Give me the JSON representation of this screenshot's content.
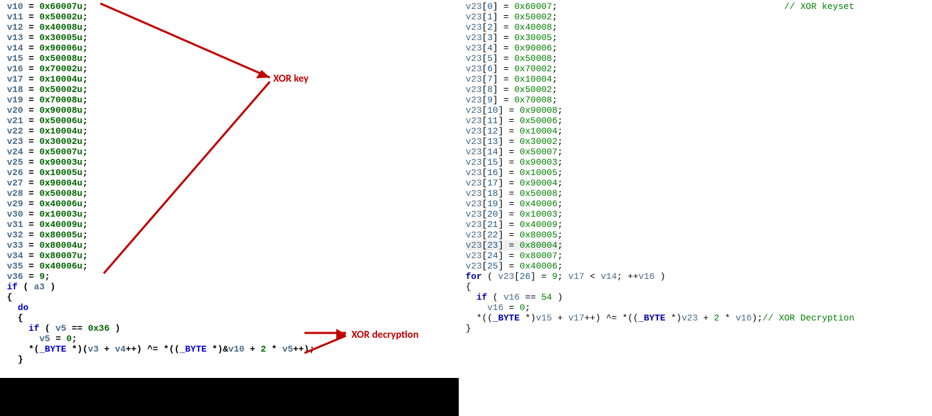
{
  "left": {
    "assignments": [
      {
        "name": "v10",
        "val": "0x60007u"
      },
      {
        "name": "v11",
        "val": "0x50002u"
      },
      {
        "name": "v12",
        "val": "0x40008u"
      },
      {
        "name": "v13",
        "val": "0x30005u"
      },
      {
        "name": "v14",
        "val": "0x90006u"
      },
      {
        "name": "v15",
        "val": "0x50008u"
      },
      {
        "name": "v16",
        "val": "0x70002u"
      },
      {
        "name": "v17",
        "val": "0x10004u"
      },
      {
        "name": "v18",
        "val": "0x50002u"
      },
      {
        "name": "v19",
        "val": "0x70008u"
      },
      {
        "name": "v20",
        "val": "0x90008u"
      },
      {
        "name": "v21",
        "val": "0x50006u"
      },
      {
        "name": "v22",
        "val": "0x10004u"
      },
      {
        "name": "v23",
        "val": "0x30002u"
      },
      {
        "name": "v24",
        "val": "0x50007u"
      },
      {
        "name": "v25",
        "val": "0x90003u"
      },
      {
        "name": "v26",
        "val": "0x10005u"
      },
      {
        "name": "v27",
        "val": "0x90004u"
      },
      {
        "name": "v28",
        "val": "0x50008u"
      },
      {
        "name": "v29",
        "val": "0x40006u"
      },
      {
        "name": "v30",
        "val": "0x10003u"
      },
      {
        "name": "v31",
        "val": "0x40009u"
      },
      {
        "name": "v32",
        "val": "0x80005u"
      },
      {
        "name": "v33",
        "val": "0x80004u"
      },
      {
        "name": "v34",
        "val": "0x80007u"
      },
      {
        "name": "v35",
        "val": "0x40006u"
      }
    ],
    "v36": {
      "name": "v36",
      "val": "9"
    },
    "if_cond_var": "a3",
    "inner_if_lhs": "v5",
    "inner_if_rhs": "0x36",
    "inner_reset_lhs": "v5",
    "inner_reset_rhs": "0",
    "xor_line_1": "*(",
    "xor_byte": "_BYTE",
    "xor_line_2": " *)(",
    "xor_v3": "v3",
    "xor_plus": " + ",
    "xor_v4": "v4",
    "xor_line_3": "++) ^= *((",
    "xor_line_4": " *)&",
    "xor_v10": "v10",
    "xor_line_5": " + ",
    "xor_two": "2",
    "xor_line_6": " * ",
    "xor_v5": "v5",
    "xor_line_7": "++);",
    "label_key": "XOR key",
    "label_decrypt": "XOR decryption"
  },
  "right": {
    "arr": "v23",
    "assignments": [
      {
        "idx": "0",
        "val": "0x60007"
      },
      {
        "idx": "1",
        "val": "0x50002"
      },
      {
        "idx": "2",
        "val": "0x40008"
      },
      {
        "idx": "3",
        "val": "0x30005"
      },
      {
        "idx": "4",
        "val": "0x90006"
      },
      {
        "idx": "5",
        "val": "0x50008"
      },
      {
        "idx": "6",
        "val": "0x70002"
      },
      {
        "idx": "7",
        "val": "0x10004"
      },
      {
        "idx": "8",
        "val": "0x50002"
      },
      {
        "idx": "9",
        "val": "0x70008"
      },
      {
        "idx": "10",
        "val": "0x90008"
      },
      {
        "idx": "11",
        "val": "0x50006"
      },
      {
        "idx": "12",
        "val": "0x10004"
      },
      {
        "idx": "13",
        "val": "0x30002"
      },
      {
        "idx": "14",
        "val": "0x50007"
      },
      {
        "idx": "15",
        "val": "0x90003"
      },
      {
        "idx": "16",
        "val": "0x10005"
      },
      {
        "idx": "17",
        "val": "0x90004"
      },
      {
        "idx": "18",
        "val": "0x50008"
      },
      {
        "idx": "19",
        "val": "0x40006"
      },
      {
        "idx": "20",
        "val": "0x10003"
      },
      {
        "idx": "21",
        "val": "0x40009"
      },
      {
        "idx": "22",
        "val": "0x80005"
      },
      {
        "idx": "23",
        "val": "0x80004"
      },
      {
        "idx": "24",
        "val": "0x80007"
      },
      {
        "idx": "25",
        "val": "0x40006"
      }
    ],
    "comment_keyset": "// XOR keyset",
    "for_init_idx": "26",
    "for_init_val": "9",
    "for_cond_lhs": "v17",
    "for_cond_rhs": "v14",
    "for_inc": "v16",
    "if_lhs": "v16",
    "if_rhs": "54",
    "reset_lhs": "v16",
    "reset_rhs": "0",
    "xor_byte": "_BYTE",
    "xor_v15": "v15",
    "xor_v17": "v17",
    "xor_v23": "v23",
    "xor_two": "2",
    "xor_v16": "v16",
    "comment_decrypt": "// XOR Decryption"
  }
}
